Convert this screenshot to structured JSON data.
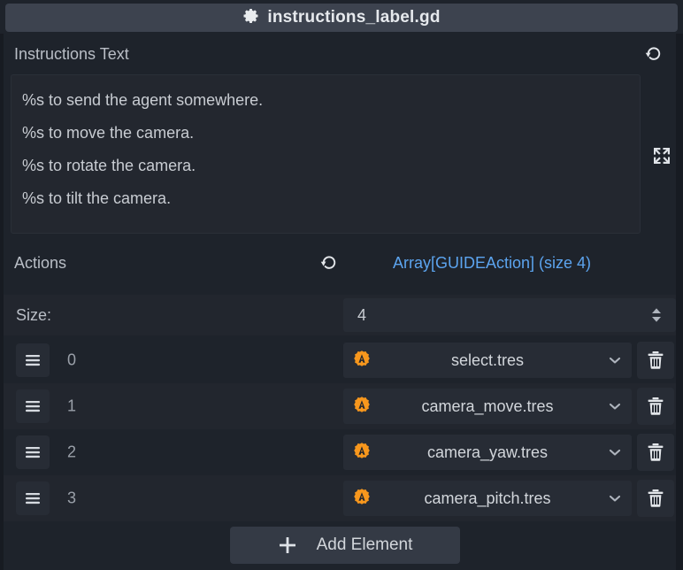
{
  "titlebar": {
    "icon": "gear-icon",
    "title": "instructions_label.gd"
  },
  "colors": {
    "panel_bg": "#1e232b",
    "row_alt_bg": "#22262e",
    "titlebar_bg": "#3d434f",
    "field_bg": "#272c35",
    "text": "#c3c8ce",
    "accent_link": "#5ca4ef",
    "resource_icon": "#f7971d"
  },
  "instructions_property": {
    "label": "Instructions Text",
    "revert_icon": "revert-icon",
    "expand_icon": "expand-icon",
    "lines": [
      "%s to send the agent somewhere.",
      "%s to move the camera.",
      "%s to rotate the camera.",
      "%s to tilt the camera."
    ]
  },
  "actions_array": {
    "label": "Actions",
    "revert_icon": "revert-icon",
    "type_text": "Array[GUIDEAction] (size 4)",
    "size_row": {
      "label": "Size:",
      "value": "4",
      "spinner_icon": "spinner-updown-icon"
    },
    "elements": [
      {
        "index": "0",
        "drag_icon": "drag-handle-icon",
        "resource_icon": "guide-action-icon",
        "resource_name": "select.tres",
        "chevron_icon": "chevron-down-icon",
        "delete_icon": "trash-icon"
      },
      {
        "index": "1",
        "drag_icon": "drag-handle-icon",
        "resource_icon": "guide-action-icon",
        "resource_name": "camera_move.tres",
        "chevron_icon": "chevron-down-icon",
        "delete_icon": "trash-icon"
      },
      {
        "index": "2",
        "drag_icon": "drag-handle-icon",
        "resource_icon": "guide-action-icon",
        "resource_name": "camera_yaw.tres",
        "chevron_icon": "chevron-down-icon",
        "delete_icon": "trash-icon"
      },
      {
        "index": "3",
        "drag_icon": "drag-handle-icon",
        "resource_icon": "guide-action-icon",
        "resource_name": "camera_pitch.tres",
        "chevron_icon": "chevron-down-icon",
        "delete_icon": "trash-icon"
      }
    ],
    "add_button": {
      "icon": "plus-icon",
      "label": "Add Element"
    }
  }
}
